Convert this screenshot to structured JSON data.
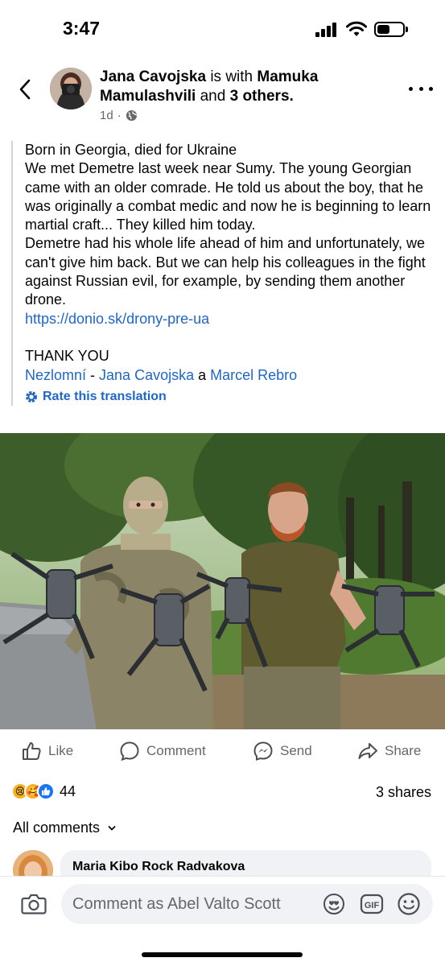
{
  "status_bar": {
    "time": "3:47",
    "icons": [
      "signal-icon",
      "wifi-icon",
      "battery-icon"
    ]
  },
  "post": {
    "author": "Jana Cavojska",
    "with_text": "is with",
    "tagged": "Mamuka Mamulashvili",
    "and_text": "and",
    "others": "3 others.",
    "time": "1d",
    "audience_icon": "globe-icon",
    "body_lines": [
      "Born in Georgia, died for Ukraine",
      "We met Demetre last week near Sumy. The young Georgian came with an older comrade. He told us about the boy, that he was originally a combat medic and now he is beginning to learn martial craft... They killed him today.",
      "Demetre had his whole life ahead of him and unfortunately, we can't give him back. But we can help his colleagues in the fight against Russian evil, for example, by sending them another drone."
    ],
    "link": "https://donio.sk/drony-pre-ua",
    "thanks": "THANK YOU",
    "credits": {
      "first": "Nezlomní",
      "dash": " - ",
      "second": "Jana Cavojska",
      "and": " a ",
      "third": "Marcel Rebro"
    },
    "rate_translation": "Rate this translation"
  },
  "actions": {
    "like": "Like",
    "comment": "Comment",
    "send": "Send",
    "share": "Share"
  },
  "engagement": {
    "reaction_icons": [
      "sad-face-icon",
      "care-face-icon",
      "like-thumb-icon"
    ],
    "reaction_count": "44",
    "shares": "3 shares"
  },
  "comments": {
    "filter_label": "All comments",
    "first_commenter": "Maria Kibo Rock Radvakova"
  },
  "composer": {
    "placeholder": "Comment as Abel Valto Scott",
    "icons": [
      "camera-icon",
      "avatar-sticker-icon",
      "gif-icon",
      "emoji-icon"
    ]
  },
  "colors": {
    "link": "#1f67c7",
    "secondary_text": "#65676b",
    "bubble_bg": "#f0f2f5"
  }
}
